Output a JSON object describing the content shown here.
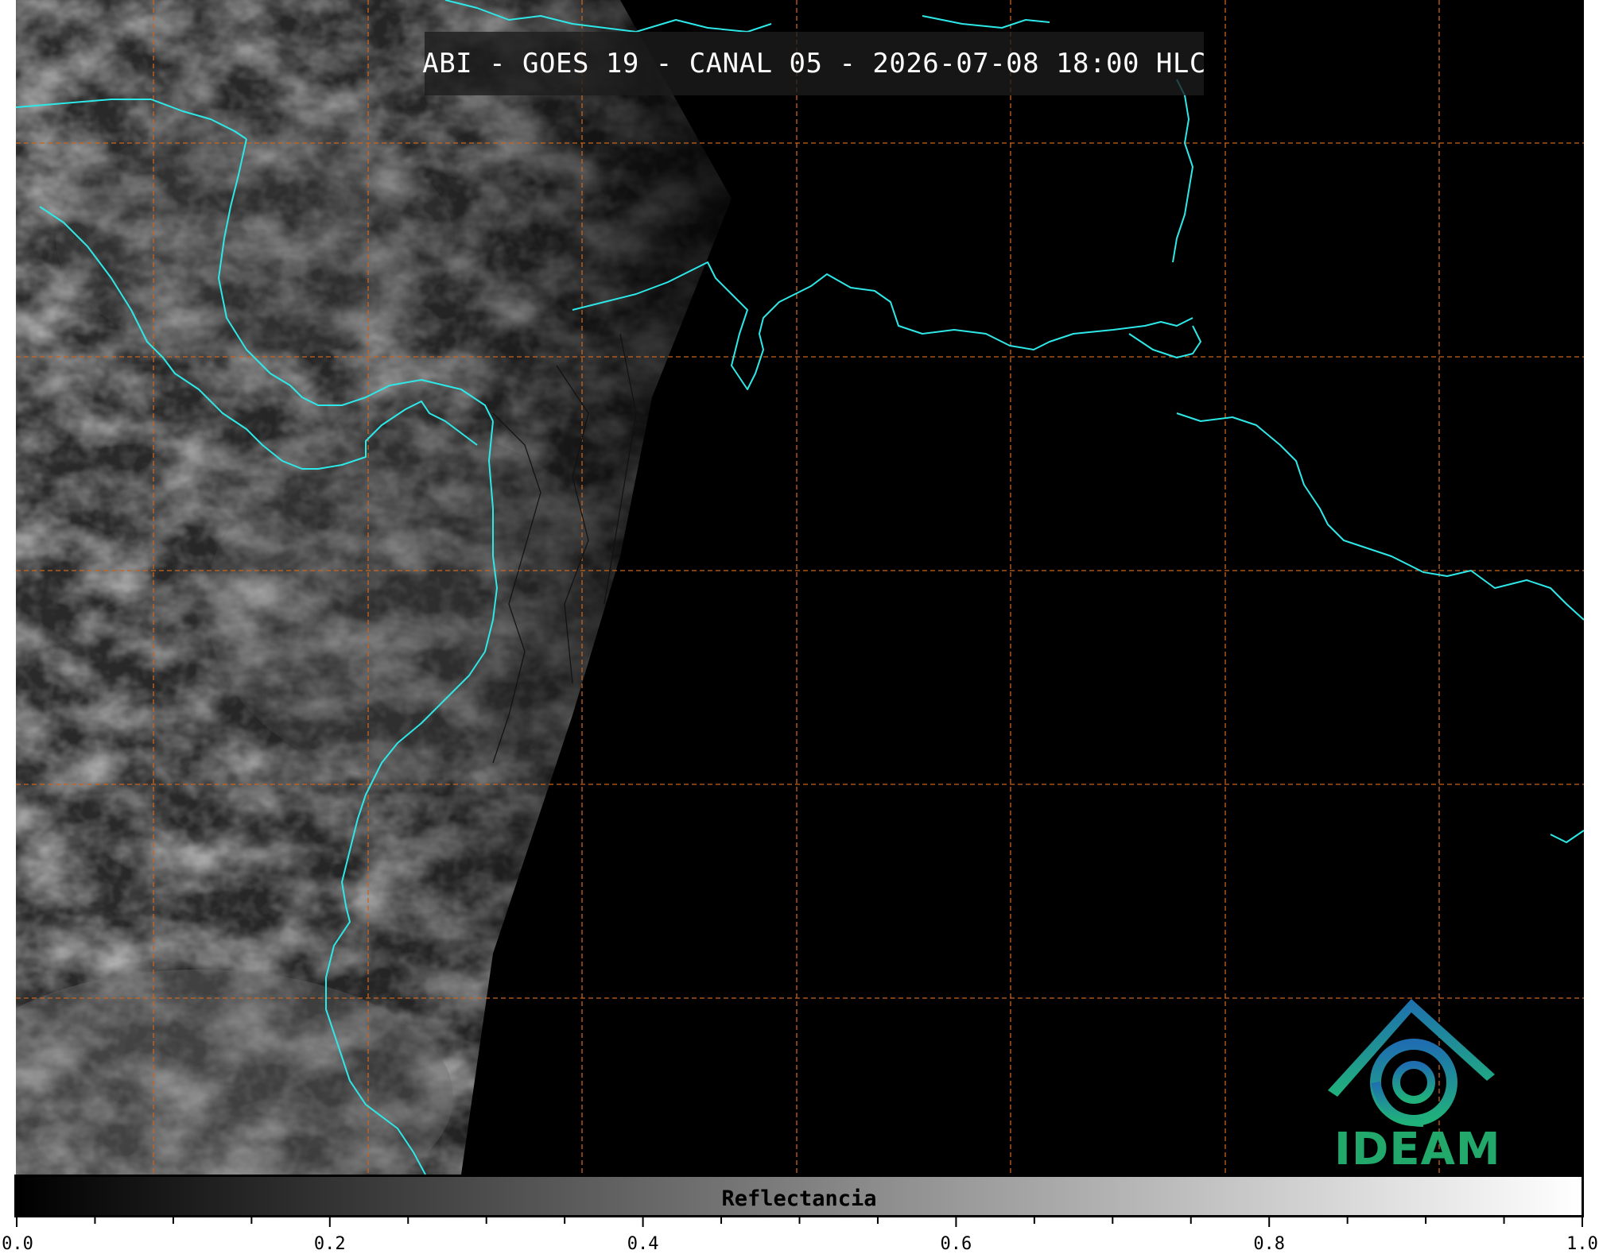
{
  "title": "ABI - GOES 19 - CANAL 05 - 2026-07-08 18:00 HLC",
  "logo": {
    "text": "IDEAM",
    "icon": "ideam-logo-icon",
    "color": "#21a86a"
  },
  "colorbar": {
    "label": "Reflectancia",
    "range": [
      0.0,
      1.0
    ],
    "colors": [
      "#000000",
      "#ffffff"
    ],
    "tick_labels": [
      {
        "value": 0.0,
        "text": "0.0"
      },
      {
        "value": 0.2,
        "text": "0.2"
      },
      {
        "value": 0.4,
        "text": "0.4"
      },
      {
        "value": 0.6,
        "text": "0.6"
      },
      {
        "value": 0.8,
        "text": "0.8"
      },
      {
        "value": 1.0,
        "text": "1.0"
      }
    ],
    "minor_tick_step": 0.05
  },
  "map": {
    "coastline_color": "#2ee8e8",
    "border_color": "#111111",
    "gridline_color": "#c8641e",
    "gridline_style": "dashed",
    "gridlines": "on"
  }
}
